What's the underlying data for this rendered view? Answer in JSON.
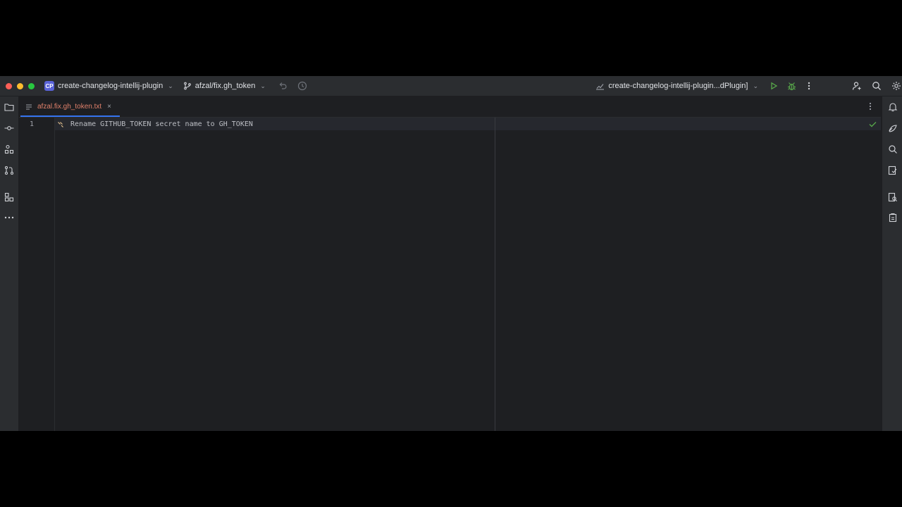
{
  "window": {
    "project_badge": "CP",
    "project_name": "create-changelog-intellij-plugin",
    "branch_name": "afzal/fix.gh_token",
    "run_config": "create-changelog-intellij-plugin...dPlugin]"
  },
  "editor": {
    "tab_label": "afzal.fix.gh_token.txt",
    "tab_close_glyph": "×",
    "line_number": "1",
    "line_text": "Rename GITHUB_TOKEN secret name to GH_TOKEN"
  },
  "colors": {
    "accent": "#3574f0",
    "tab_text": "#e0806a",
    "run_green": "#57a64a",
    "project_badge": "#5a63d8"
  }
}
